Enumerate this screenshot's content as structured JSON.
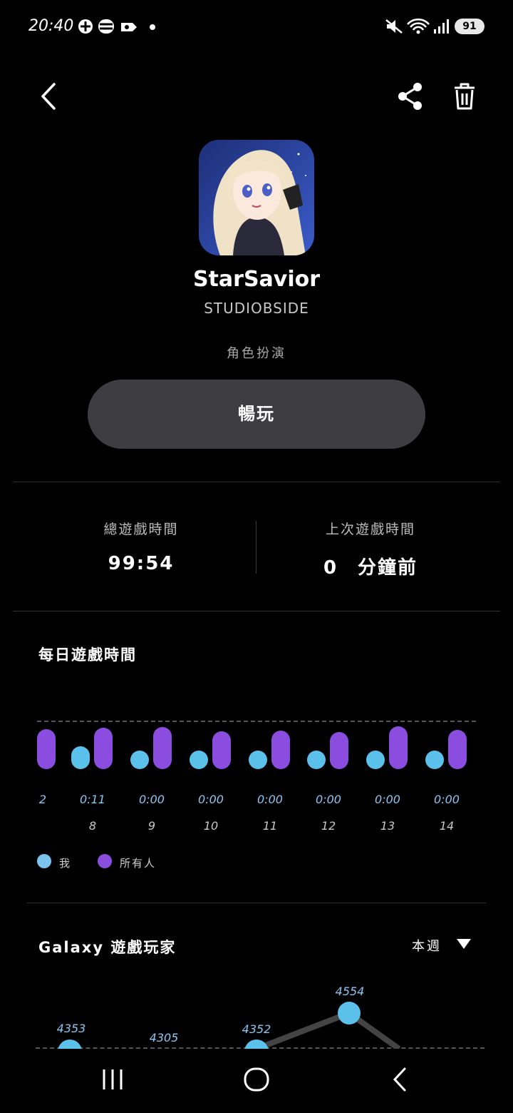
{
  "status_bar": {
    "time": "20:40",
    "battery": "91"
  },
  "app": {
    "name": "StarSavior",
    "developer": "STUDIOBSIDE",
    "category": "角色扮演",
    "play_label": "暢玩"
  },
  "stats": {
    "total_label": "總遊戲時間",
    "total_value": "99:54",
    "last_label": "上次遊戲時間",
    "last_value": "0　分鐘前"
  },
  "daily": {
    "title": "每日遊戲時間",
    "legend_me": "我",
    "legend_all": "所有人",
    "colors": {
      "me": "#5bc0ea",
      "all": "#8a4de0"
    },
    "days": [
      {
        "me_label": "2",
        "date": ""
      },
      {
        "me_label": "0:11",
        "date": "8"
      },
      {
        "me_label": "0:00",
        "date": "9"
      },
      {
        "me_label": "0:00",
        "date": "10"
      },
      {
        "me_label": "0:00",
        "date": "11"
      },
      {
        "me_label": "0:00",
        "date": "12"
      },
      {
        "me_label": "0:00",
        "date": "13"
      },
      {
        "me_label": "0:00",
        "date": "14"
      }
    ]
  },
  "players": {
    "title": "Galaxy 遊戲玩家",
    "period": "本週",
    "points": [
      {
        "label": "4353"
      },
      {
        "label": "4305"
      },
      {
        "label": "4352"
      },
      {
        "label": "4554"
      }
    ]
  }
}
